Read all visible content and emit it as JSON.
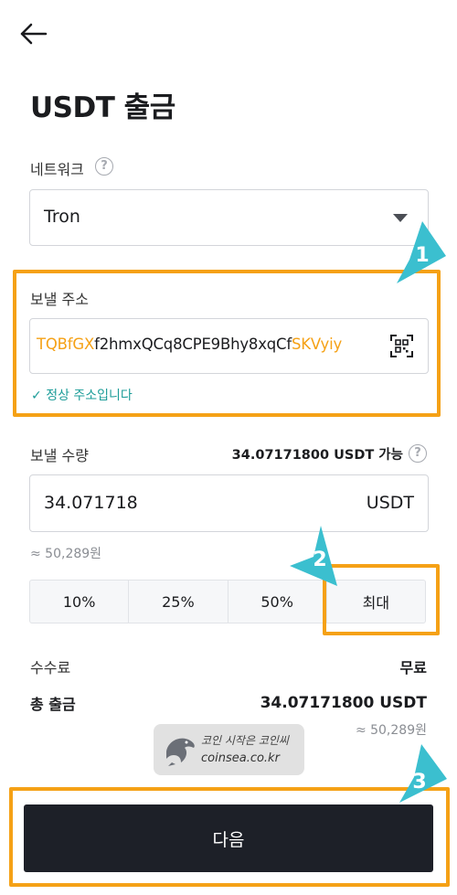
{
  "header": {
    "title": "USDT 출금"
  },
  "network": {
    "label": "네트워크",
    "help": "?",
    "value": "Tron"
  },
  "address": {
    "label": "보낼 주소",
    "prefix": "TQBfGX",
    "middle": "f2hmxQCq8CPE9Bhy8xqCf",
    "suffix": "SKVyiy",
    "valid_message": "정상 주소입니다"
  },
  "amount": {
    "label": "보낼 수량",
    "available": "34.07171800 USDT 가능",
    "help": "?",
    "value": "34.071718",
    "unit": "USDT",
    "krw_approx": "≈ 50,289원",
    "percent_buttons": [
      "10%",
      "25%",
      "50%",
      "최대"
    ]
  },
  "fee": {
    "label": "수수료",
    "value": "무료"
  },
  "total": {
    "label": "총 출금",
    "value": "34.07171800 USDT",
    "krw_approx": "≈ 50,289원"
  },
  "watermark": {
    "line1": "코인 시작은 코인씨",
    "line2": "coinsea.co.kr"
  },
  "next_button": {
    "label": "다음"
  },
  "markers": [
    "1",
    "2",
    "3"
  ],
  "colors": {
    "highlight": "#f5a116",
    "marker": "#3bbfcf",
    "valid": "#1b9c98",
    "button": "#1d2028"
  }
}
